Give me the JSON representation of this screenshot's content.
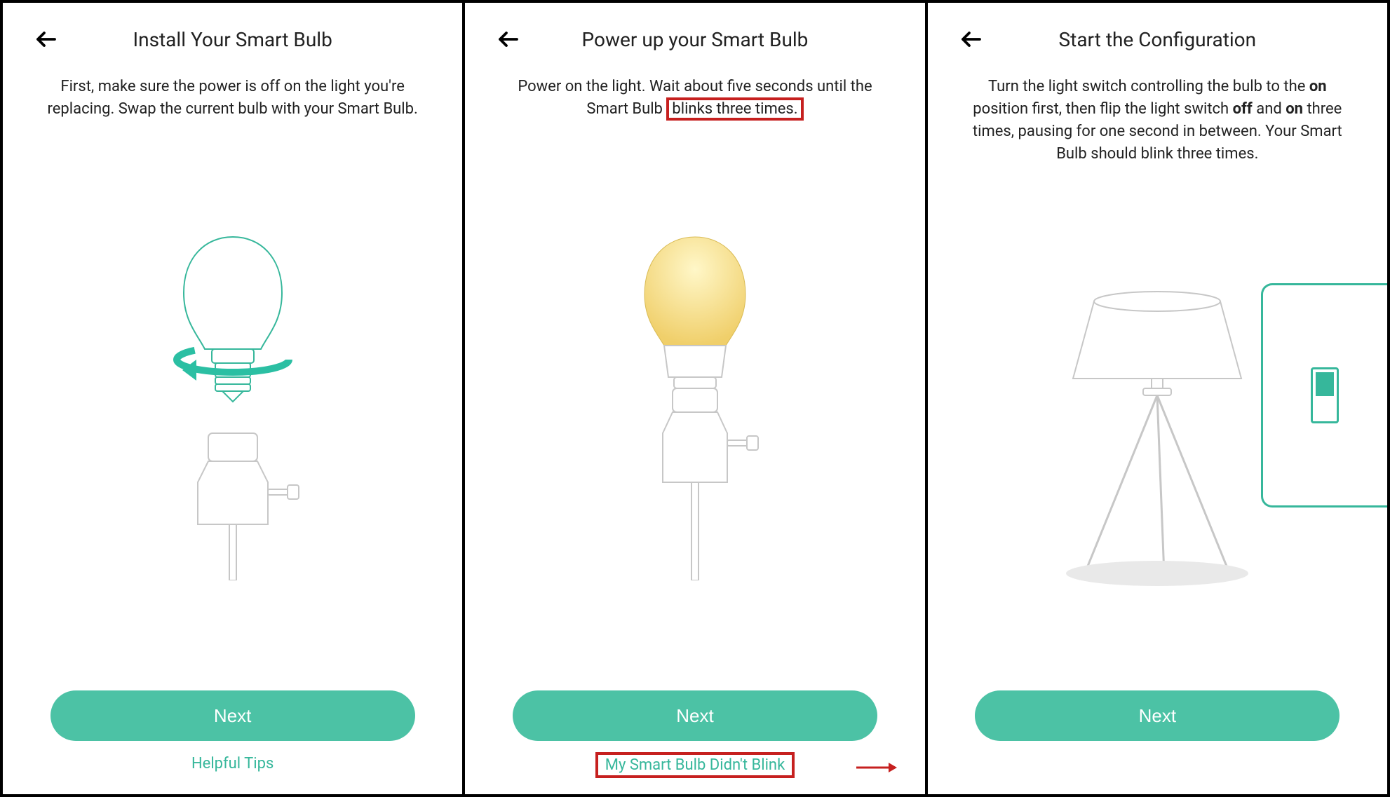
{
  "accent_color": "#4cc2a5",
  "annotation_color": "#c6201f",
  "panel1": {
    "title": "Install Your Smart Bulb",
    "instruction": "First, make sure the power is off on the light you're replacing. Swap the current bulb with your Smart Bulb.",
    "next_label": "Next",
    "footer_link": "Helpful Tips"
  },
  "panel2": {
    "title": "Power up your Smart Bulb",
    "instruction_pre": "Power on the light. Wait about five seconds until the Smart Bulb ",
    "instruction_highlight": "blinks three times.",
    "next_label": "Next",
    "footer_link": "My Smart Bulb Didn't Blink"
  },
  "panel3": {
    "title": "Start the Configuration",
    "instruction_parts": {
      "p1": "Turn the light switch controlling the bulb to the ",
      "b1": "on",
      "p2": " position first, then flip the light switch ",
      "b2": "off",
      "p3": " and ",
      "b3": "on",
      "p4": " three times, pausing for one second in between. Your Smart Bulb should blink three times."
    },
    "next_label": "Next"
  }
}
